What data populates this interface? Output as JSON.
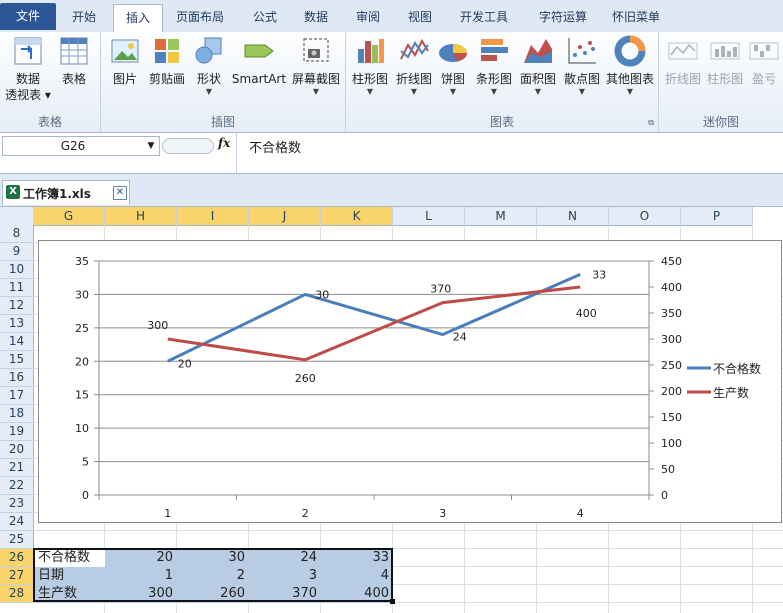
{
  "ribbon_tabs": [
    "文件",
    "开始",
    "插入",
    "页面布局",
    "公式",
    "数据",
    "审阅",
    "视图",
    "开发工具",
    "字符运算",
    "怀旧菜单"
  ],
  "active_tab": "插入",
  "groups": {
    "table": {
      "label": "表格",
      "pivot_label_1": "数据",
      "pivot_label_2": "透视表",
      "table_label": "表格"
    },
    "illustrations": {
      "label": "插图",
      "picture": "图片",
      "clipart": "剪贴画",
      "shapes": "形状",
      "smartart": "SmartArt",
      "screenshot": "屏幕截图"
    },
    "charts": {
      "label": "图表",
      "column": "柱形图",
      "line": "折线图",
      "pie": "饼图",
      "bar": "条形图",
      "area": "面积图",
      "scatter": "散点图",
      "other": "其他图表"
    },
    "sparklines": {
      "label": "迷你图",
      "line": "折线图",
      "column": "柱形图",
      "winloss": "盈亏"
    }
  },
  "formula_bar": {
    "name_box": "G26",
    "fx": "fx",
    "content": "不合格数"
  },
  "workbook_tab": "工作簿1.xls",
  "columns": [
    "G",
    "H",
    "I",
    "J",
    "K",
    "L",
    "M",
    "N",
    "O",
    "P"
  ],
  "rows": [
    "8",
    "9",
    "10",
    "11",
    "12",
    "13",
    "14",
    "15",
    "16",
    "17",
    "18",
    "19",
    "20",
    "21",
    "22",
    "23",
    "24",
    "25",
    "26",
    "27",
    "28"
  ],
  "table": [
    {
      "label": "不合格数",
      "values": [
        "20",
        "30",
        "24",
        "33"
      ]
    },
    {
      "label": "日期",
      "values": [
        "1",
        "2",
        "3",
        "4"
      ]
    },
    {
      "label": "生产数",
      "values": [
        "300",
        "260",
        "370",
        "400"
      ]
    }
  ],
  "colors": {
    "series1": "#4a7ebb",
    "series2": "#be4b48",
    "accent_tab": "#2b5797",
    "selected_header": "#f8d46a",
    "data_fill": "#b8cce4"
  },
  "chart_data": {
    "type": "line",
    "categories": [
      "1",
      "2",
      "3",
      "4"
    ],
    "series": [
      {
        "name": "不合格数",
        "axis": "left",
        "values": [
          20,
          30,
          24,
          33
        ],
        "labels": [
          "20",
          "30",
          "24",
          "33"
        ],
        "color": "#4a7ebb"
      },
      {
        "name": "生产数",
        "axis": "right",
        "values": [
          300,
          260,
          370,
          400
        ],
        "labels": [
          "300",
          "260",
          "370",
          "400"
        ],
        "color": "#be4b48"
      }
    ],
    "y_left": {
      "min": 0,
      "max": 35,
      "step": 5,
      "ticks": [
        "0",
        "5",
        "10",
        "15",
        "20",
        "25",
        "30",
        "35"
      ]
    },
    "y_right": {
      "min": 0,
      "max": 450,
      "step": 50,
      "ticks": [
        "0",
        "50",
        "100",
        "150",
        "200",
        "250",
        "300",
        "350",
        "400",
        "450"
      ]
    },
    "grid": true,
    "legend": "right"
  }
}
